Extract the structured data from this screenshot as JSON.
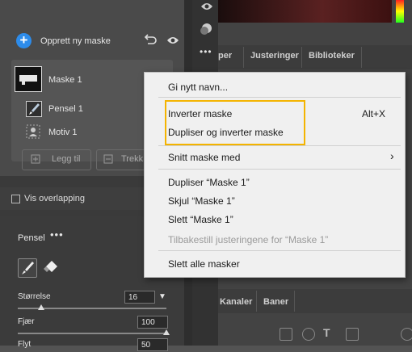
{
  "masks_panel": {
    "create_label": "Opprett ny maske",
    "mask_label": "Maske 1",
    "pensel_row": "Pensel 1",
    "motiv_row": "Motiv 1",
    "add_button": "Legg til",
    "subtract_button": "Trekk",
    "overlay_label": "Vis overlapping"
  },
  "brush": {
    "title": "Pensel",
    "more": "•••",
    "size_label": "Størrelse",
    "size_value": "16",
    "size_level": 16,
    "feather_label": "Fjær",
    "feather_value": "100",
    "feather_level": 100,
    "flow_label": "Flyt",
    "flow_value": "50"
  },
  "toolbar": {
    "more": "•••"
  },
  "tabs": {
    "top": [
      "per",
      "Justeringer",
      "Biblioteker"
    ],
    "bottom": [
      "Kanaler",
      "Baner"
    ]
  },
  "context_menu": {
    "rename": "Gi nytt navn...",
    "invert": "Inverter maske",
    "invert_shortcut": "Alt+X",
    "duplicate_invert": "Dupliser og inverter maske",
    "intersect": "Snitt maske med",
    "intersect_arrow": "›",
    "duplicate": "Dupliser “Maske 1”",
    "hide": "Skjul “Maske 1”",
    "delete": "Slett “Maske 1”",
    "reset": "Tilbakestill justeringene for “Maske 1”",
    "delete_all": "Slett alle masker"
  },
  "colors": {
    "accent": "#2d8ceb",
    "highlight_box": "#f4b400"
  }
}
